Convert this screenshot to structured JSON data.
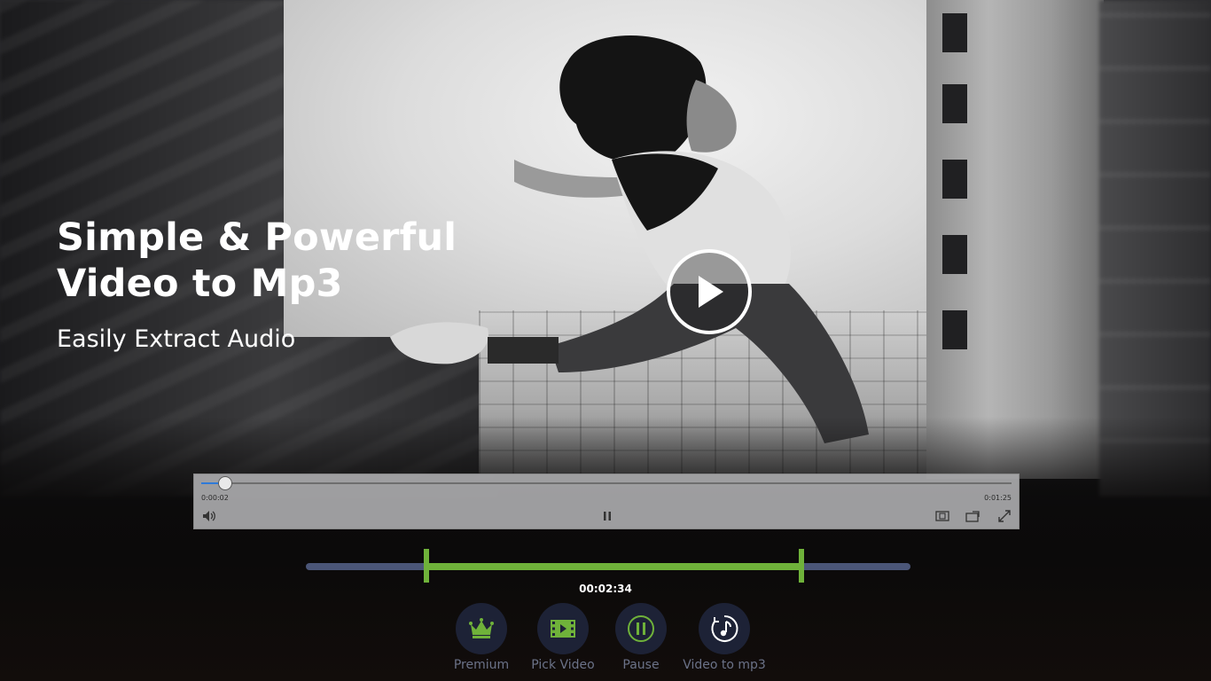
{
  "hero": {
    "title_line1": "Simple & Powerful",
    "title_line2": "Video to Mp3",
    "subtitle": "Easily Extract Audio"
  },
  "player": {
    "elapsed": "0:00:02",
    "duration": "0:01:25",
    "progress_fraction": 0.03,
    "icons": {
      "volume": "volume-icon",
      "pause": "pause-icon",
      "aspect": "aspect-ratio-icon",
      "cast": "cast-icon",
      "fullscreen": "fullscreen-icon"
    }
  },
  "trim": {
    "start_fraction": 0.2,
    "end_fraction": 0.82,
    "selected_length": "00:02:34"
  },
  "actions": [
    {
      "id": "premium",
      "label": "Premium",
      "icon": "crown-icon",
      "color": "#6fb23a"
    },
    {
      "id": "pick-video",
      "label": "Pick Video",
      "icon": "film-icon",
      "color": "#6fb23a"
    },
    {
      "id": "pause",
      "label": "Pause",
      "icon": "pause-icon",
      "color": "#6fb23a"
    },
    {
      "id": "video-to-mp3",
      "label": "Video to mp3",
      "icon": "music-note-icon",
      "color": "#ffffff"
    }
  ],
  "colors": {
    "accent_green": "#6fb23a",
    "seek_blue": "#2f7ad8",
    "button_bg": "#1d2236",
    "label_gray": "#6b7288"
  }
}
